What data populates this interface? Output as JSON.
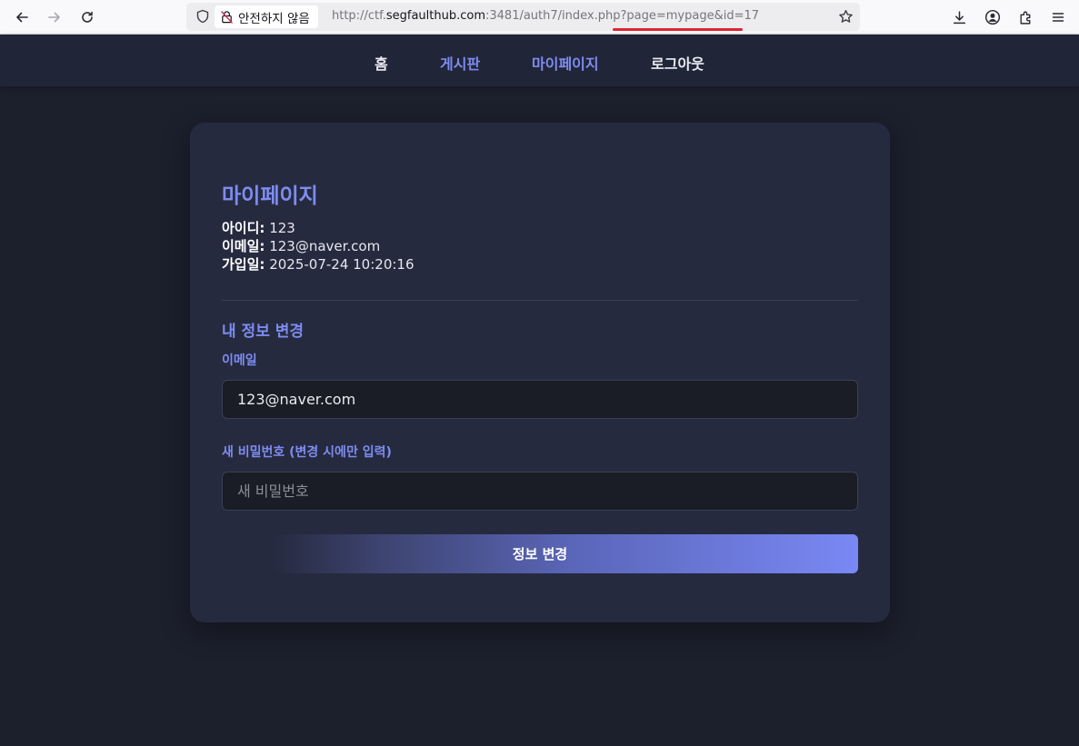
{
  "browser": {
    "security_label": "안전하지 않음",
    "url_prefix": "http://ctf.",
    "url_host": "segfaulthub.com",
    "url_rest": ":3481/auth7/index.php?page=mypage&id=17"
  },
  "nav": {
    "home": "홈",
    "board": "게시판",
    "mypage": "마이페이지",
    "logout": "로그아웃"
  },
  "profile": {
    "title": "마이페이지",
    "id_label": "아이디:",
    "id_value": "123",
    "email_label": "이메일:",
    "email_value": "123@naver.com",
    "joined_label": "가입일:",
    "joined_value": "2025-07-24 10:20:16"
  },
  "form": {
    "section_title": "내 정보 변경",
    "email_label": "이메일",
    "email_value": "123@naver.com",
    "password_label": "새 비밀번호 (변경 시에만 입력)",
    "password_placeholder": "새 비밀번호",
    "submit_label": "정보 변경"
  },
  "colors": {
    "page_bg": "#1c1f2c",
    "card_bg": "#262a3f",
    "accent": "#7d8cf0",
    "url_underline": "#e0242f"
  }
}
